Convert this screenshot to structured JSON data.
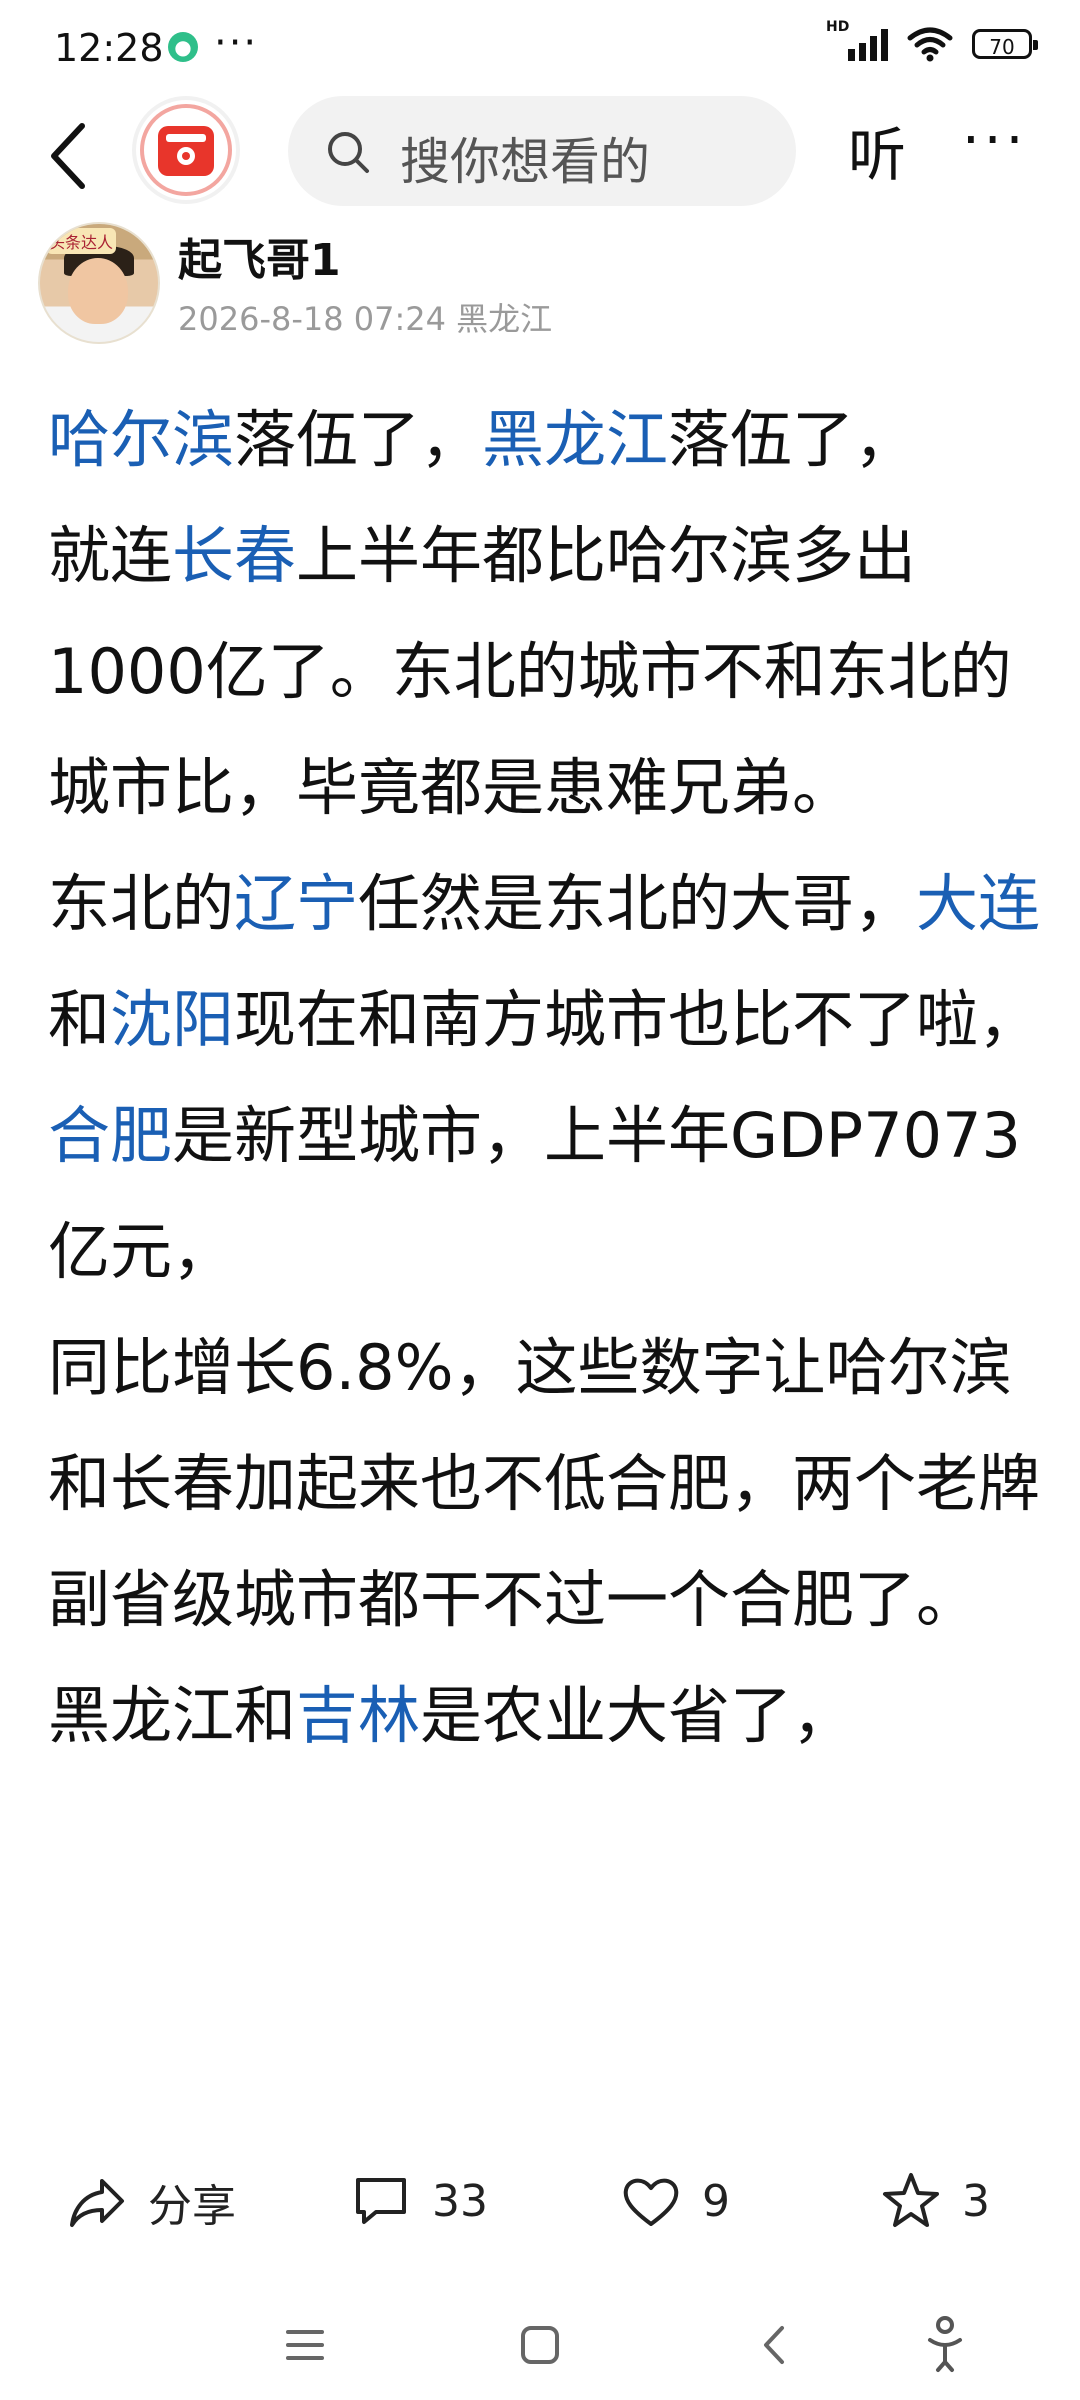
{
  "status_bar": {
    "time": "12:28",
    "more": "···",
    "network_label": "HD",
    "battery": "70"
  },
  "nav": {
    "search_placeholder": "搜你想看的",
    "listen_label": "听",
    "more_label": "···"
  },
  "author": {
    "name": "起飞哥1",
    "meta": "2026-8-18 07:24 黑龙江",
    "avatar_tag": "头条达人"
  },
  "article": {
    "p1": [
      {
        "text": "哈尔滨",
        "link": true
      },
      {
        "text": "落伍了，",
        "link": false
      },
      {
        "text": "黑龙江",
        "link": true
      },
      {
        "text": "落伍了，",
        "link": false
      }
    ],
    "p2": [
      {
        "text": "就连",
        "link": false
      },
      {
        "text": "长春",
        "link": true
      },
      {
        "text": "上半年都比哈尔滨多出1000亿了。东北的城市不和东北的城市比，毕竟都是患难兄弟。",
        "link": false
      }
    ],
    "p3": [
      {
        "text": "东北的",
        "link": false
      },
      {
        "text": "辽宁",
        "link": true
      },
      {
        "text": "任然是东北的大哥，",
        "link": false
      },
      {
        "text": "大连",
        "link": true
      },
      {
        "text": "和",
        "link": false
      },
      {
        "text": "沈阳",
        "link": true
      },
      {
        "text": "现在和南方城市也比不了啦，",
        "link": false
      },
      {
        "text": "合肥",
        "link": true
      },
      {
        "text": "是新型城市，上半年GDP7073亿元，",
        "link": false
      }
    ],
    "p4": [
      {
        "text": "同比增长6.8%，这些数字让哈尔滨和长春加起来也不低合肥，两个老牌副省级城市都干不过一个合肥了。",
        "link": false
      }
    ],
    "p5": [
      {
        "text": "黑龙江和",
        "link": false
      },
      {
        "text": "吉林",
        "link": true
      },
      {
        "text": "是农业大省了，",
        "link": false
      }
    ]
  },
  "actions": {
    "share_label": "分享",
    "comment_count": "33",
    "like_count": "9",
    "favorite_count": "3"
  },
  "colors": {
    "link": "#1a5fb4",
    "meta": "#9a9a9a",
    "search_bg": "#f2f2f2",
    "logo_red": "#e8352b"
  }
}
